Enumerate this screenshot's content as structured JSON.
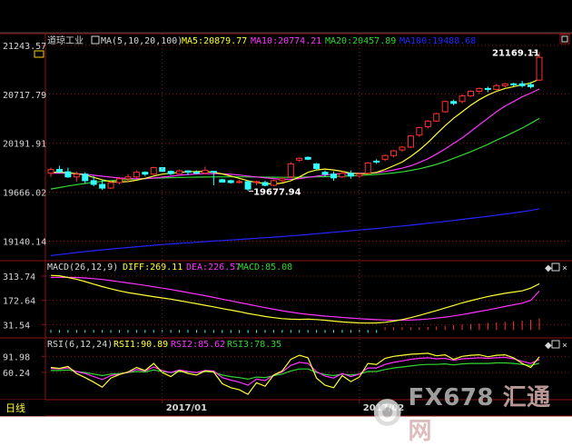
{
  "colors": {
    "bg": "#000000",
    "axis": "#8c1515",
    "text": "#d6d6d6",
    "yellow": "#ffff33",
    "magenta": "#ff33ff",
    "green": "#33d633",
    "blue": "#2424ff",
    "up": "#ff3333",
    "down": "#33ffff",
    "label": "#ffffff"
  },
  "main_panel": {
    "instrument": "道琼工业",
    "ma_params": "MA(5,10,20,100)",
    "ma5": "MA5:20879.77",
    "ma10": "MA10:20774.21",
    "ma20": "MA20:20457.89",
    "ma100": "MA100:19488.68",
    "high_label": "21169.11",
    "low_label": "19677.94"
  },
  "macd_panel": {
    "params": "MACD(26,12,9)",
    "diff": "DIFF:269.11",
    "dea": "DEA:226.57",
    "macd": "MACD:85.08"
  },
  "rsi_panel": {
    "params": "RSI(6,12,24)",
    "rsi1": "RSI1:90.89",
    "rsi2": "RSI2:85.62",
    "rsi3": "RSI3:78.35"
  },
  "period_label": "日线",
  "watermark": {
    "prefix": "FX678",
    "suffix": "汇通网"
  },
  "chart_data": [
    {
      "type": "candlestick",
      "title": "道琼工业",
      "x_labels": [
        "2017/01",
        "2017/02"
      ],
      "y_ticks": [
        21243.57,
        20717.79,
        20191.91,
        19666.02,
        19140.14
      ],
      "ylim": [
        18950,
        21340
      ],
      "candles": [
        {
          "o": 19870,
          "h": 19930,
          "l": 19830,
          "c": 19910
        },
        {
          "o": 19910,
          "h": 19950,
          "l": 19870,
          "c": 19885
        },
        {
          "o": 19885,
          "h": 19930,
          "l": 19820,
          "c": 19830
        },
        {
          "o": 19830,
          "h": 19890,
          "l": 19780,
          "c": 19860
        },
        {
          "o": 19860,
          "h": 19880,
          "l": 19760,
          "c": 19790
        },
        {
          "o": 19790,
          "h": 19840,
          "l": 19730,
          "c": 19750
        },
        {
          "o": 19750,
          "h": 19800,
          "l": 19690,
          "c": 19710
        },
        {
          "o": 19710,
          "h": 19790,
          "l": 19700,
          "c": 19770
        },
        {
          "o": 19770,
          "h": 19830,
          "l": 19750,
          "c": 19810
        },
        {
          "o": 19810,
          "h": 19860,
          "l": 19770,
          "c": 19830
        },
        {
          "o": 19830,
          "h": 19900,
          "l": 19810,
          "c": 19880
        },
        {
          "o": 19880,
          "h": 19890,
          "l": 19840,
          "c": 19860
        },
        {
          "o": 19860,
          "h": 19940,
          "l": 19850,
          "c": 19930
        },
        {
          "o": 19930,
          "h": 19935,
          "l": 19880,
          "c": 19890
        },
        {
          "o": 19890,
          "h": 19900,
          "l": 19850,
          "c": 19865
        },
        {
          "o": 19865,
          "h": 19910,
          "l": 19860,
          "c": 19895
        },
        {
          "o": 19895,
          "h": 19900,
          "l": 19850,
          "c": 19880
        },
        {
          "o": 19880,
          "h": 19900,
          "l": 19860,
          "c": 19870
        },
        {
          "o": 19870,
          "h": 19940,
          "l": 19860,
          "c": 19900
        },
        {
          "o": 19890,
          "h": 19895,
          "l": 19740,
          "c": 19885
        },
        {
          "o": 19800,
          "h": 19810,
          "l": 19770,
          "c": 19775
        },
        {
          "o": 19790,
          "h": 19800,
          "l": 19760,
          "c": 19770
        },
        {
          "o": 19775,
          "h": 19800,
          "l": 19760,
          "c": 19780
        },
        {
          "o": 19780,
          "h": 19790,
          "l": 19677.94,
          "c": 19700
        },
        {
          "o": 19770,
          "h": 19790,
          "l": 19740,
          "c": 19780
        },
        {
          "o": 19770,
          "h": 19790,
          "l": 19730,
          "c": 19740
        },
        {
          "o": 19740,
          "h": 19800,
          "l": 19730,
          "c": 19790
        },
        {
          "o": 19790,
          "h": 19830,
          "l": 19770,
          "c": 19810
        },
        {
          "o": 19830,
          "h": 19990,
          "l": 19820,
          "c": 19970
        },
        {
          "o": 20010,
          "h": 20040,
          "l": 19990,
          "c": 20030
        },
        {
          "o": 20040,
          "h": 20050,
          "l": 20010,
          "c": 20020
        },
        {
          "o": 19970,
          "h": 19980,
          "l": 19900,
          "c": 19920
        },
        {
          "o": 19880,
          "h": 19900,
          "l": 19830,
          "c": 19860
        },
        {
          "o": 19860,
          "h": 19890,
          "l": 19790,
          "c": 19820
        },
        {
          "o": 19830,
          "h": 19890,
          "l": 19820,
          "c": 19870
        },
        {
          "o": 19870,
          "h": 19900,
          "l": 19810,
          "c": 19840
        },
        {
          "o": 19840,
          "h": 19870,
          "l": 19820,
          "c": 19860
        },
        {
          "o": 19870,
          "h": 19990,
          "l": 19860,
          "c": 19980
        },
        {
          "o": 20000,
          "h": 20020,
          "l": 19970,
          "c": 19990
        },
        {
          "o": 20020,
          "h": 20070,
          "l": 20000,
          "c": 20060
        },
        {
          "o": 20060,
          "h": 20120,
          "l": 20040,
          "c": 20110
        },
        {
          "o": 20120,
          "h": 20160,
          "l": 20100,
          "c": 20150
        },
        {
          "o": 20150,
          "h": 20280,
          "l": 20140,
          "c": 20270
        },
        {
          "o": 20280,
          "h": 20370,
          "l": 20260,
          "c": 20360
        },
        {
          "o": 20370,
          "h": 20440,
          "l": 20350,
          "c": 20430
        },
        {
          "o": 20430,
          "h": 20520,
          "l": 20420,
          "c": 20510
        },
        {
          "o": 20530,
          "h": 20650,
          "l": 20520,
          "c": 20640
        },
        {
          "o": 20640,
          "h": 20660,
          "l": 20600,
          "c": 20620
        },
        {
          "o": 20640,
          "h": 20720,
          "l": 20620,
          "c": 20700
        },
        {
          "o": 20700,
          "h": 20760,
          "l": 20690,
          "c": 20750
        },
        {
          "o": 20750,
          "h": 20790,
          "l": 20720,
          "c": 20780
        },
        {
          "o": 20780,
          "h": 20800,
          "l": 20740,
          "c": 20770
        },
        {
          "o": 20770,
          "h": 20830,
          "l": 20760,
          "c": 20810
        },
        {
          "o": 20810,
          "h": 20840,
          "l": 20790,
          "c": 20830
        },
        {
          "o": 20830,
          "h": 20840,
          "l": 20800,
          "c": 20820
        },
        {
          "o": 20830,
          "h": 20860,
          "l": 20790,
          "c": 20810
        },
        {
          "o": 20820,
          "h": 20850,
          "l": 20780,
          "c": 20800
        },
        {
          "o": 20870,
          "h": 21169.11,
          "l": 20860,
          "c": 21115
        }
      ],
      "ma": {
        "MA5": [
          19880,
          19882,
          19875,
          19865,
          19850,
          19825,
          19800,
          19780,
          19775,
          19780,
          19795,
          19815,
          19840,
          19860,
          19870,
          19880,
          19885,
          19888,
          19887,
          19880,
          19862,
          19840,
          19815,
          19790,
          19770,
          19760,
          19755,
          19765,
          19790,
          19830,
          19880,
          19905,
          19915,
          19905,
          19890,
          19870,
          19865,
          19865,
          19880,
          19910,
          19950,
          19990,
          20050,
          20120,
          20200,
          20290,
          20380,
          20460,
          20530,
          20600,
          20660,
          20710,
          20750,
          20780,
          20800,
          20820,
          20840,
          20879.77
        ],
        "MA10": [
          19870,
          19872,
          19870,
          19865,
          19858,
          19848,
          19838,
          19828,
          19818,
          19812,
          19810,
          19812,
          19818,
          19828,
          19838,
          19848,
          19856,
          19862,
          19865,
          19866,
          19864,
          19858,
          19850,
          19840,
          19830,
          19820,
          19812,
          19805,
          19805,
          19812,
          19825,
          19838,
          19850,
          19860,
          19865,
          19868,
          19868,
          19870,
          19876,
          19888,
          19905,
          19925,
          19950,
          19985,
          20025,
          20075,
          20130,
          20190,
          20250,
          20320,
          20390,
          20460,
          20530,
          20590,
          20640,
          20690,
          20730,
          20774.21
        ],
        "MA20": [
          19700,
          19716,
          19732,
          19747,
          19760,
          19772,
          19782,
          19790,
          19797,
          19803,
          19808,
          19812,
          19816,
          19819,
          19822,
          19824,
          19826,
          19828,
          19829,
          19830,
          19831,
          19831,
          19831,
          19830,
          19829,
          19828,
          19827,
          19826,
          19826,
          19827,
          19829,
          19831,
          19833,
          19836,
          19839,
          19842,
          19846,
          19851,
          19857,
          19864,
          19873,
          19885,
          19900,
          19918,
          19940,
          19965,
          19995,
          20030,
          20065,
          20100,
          20140,
          20180,
          20225,
          20265,
          20310,
          20355,
          20405,
          20457.89
        ],
        "MA100": [
          18985,
          18996,
          19007,
          19018,
          19028,
          19038,
          19047,
          19056,
          19064,
          19072,
          19080,
          19088,
          19096,
          19103,
          19110,
          19117,
          19123,
          19129,
          19135,
          19141,
          19147,
          19153,
          19159,
          19165,
          19171,
          19177,
          19183,
          19190,
          19197,
          19204,
          19212,
          19220,
          19228,
          19236,
          19244,
          19252,
          19260,
          19268,
          19276,
          19285,
          19294,
          19303,
          19312,
          19322,
          19332,
          19342,
          19352,
          19363,
          19374,
          19385,
          19396,
          19408,
          19420,
          19432,
          19444,
          19456,
          19470,
          19488.68
        ]
      }
    },
    {
      "type": "line",
      "title": "MACD(26,12,9)",
      "y_ticks": [
        313.74,
        172.64,
        31.54
      ],
      "ylim": [
        -25,
        335
      ],
      "series": [
        {
          "name": "DIFF",
          "values": [
            318,
            316,
            306,
            296,
            282,
            267,
            253,
            240,
            228,
            218,
            210,
            202,
            194,
            187,
            180,
            171,
            162,
            153,
            144,
            135,
            125,
            116,
            107,
            96,
            88,
            79,
            72,
            66,
            63,
            62,
            63,
            61,
            57,
            52,
            47,
            44,
            41,
            40,
            41,
            45,
            52,
            61,
            72,
            85,
            99,
            113,
            128,
            143,
            158,
            171,
            183,
            195,
            205,
            214,
            221,
            228,
            244,
            269.11
          ]
        },
        {
          "name": "DEA",
          "values": [
            306,
            307,
            307,
            306,
            303,
            299,
            294,
            288,
            281,
            274,
            267,
            260,
            252,
            244,
            236,
            227,
            218,
            209,
            200,
            190,
            180,
            170,
            160,
            150,
            140,
            130,
            121,
            112,
            104,
            97,
            91,
            86,
            81,
            77,
            73,
            70,
            66,
            63,
            60,
            58,
            57,
            57,
            58,
            60,
            64,
            69,
            75,
            82,
            90,
            99,
            108,
            117,
            127,
            137,
            147,
            156,
            173,
            226.57
          ]
        },
        {
          "name": "MACD",
          "values": [
            -3,
            -4,
            -5,
            -6,
            -7,
            -8,
            -9,
            -10,
            -12,
            -14,
            -15,
            -16,
            -17,
            -18,
            -18,
            -19,
            -20,
            -20,
            -21,
            -21,
            -22,
            -22,
            -23,
            -22,
            -21,
            -20,
            -19,
            -18,
            -16,
            -14,
            -12,
            -10,
            -9,
            -8,
            -7,
            -6,
            -5,
            -4,
            -2,
            2,
            5,
            9,
            13,
            18,
            22,
            26,
            30,
            35,
            40,
            44,
            48,
            52,
            56,
            60,
            64,
            68,
            74,
            85.08
          ]
        }
      ]
    },
    {
      "type": "line",
      "title": "RSI(6,12,24)",
      "y_ticks": [
        91.98,
        60.24
      ],
      "ylim": [
        10,
        105
      ],
      "series": [
        {
          "name": "RSI1",
          "values": [
            70,
            68,
            72,
            58,
            50,
            41,
            31,
            49,
            56,
            61,
            70,
            64,
            78,
            60,
            52,
            64,
            58,
            55,
            63,
            61,
            38,
            30,
            26,
            17,
            40,
            33,
            55,
            63,
            86,
            94,
            89,
            49,
            35,
            30,
            54,
            42,
            51,
            78,
            76,
            88,
            92,
            94,
            96,
            97,
            98,
            93,
            95,
            86,
            92,
            94,
            95,
            91,
            94,
            95,
            89,
            78,
            70,
            90.89
          ]
        },
        {
          "name": "RSI2",
          "values": [
            68,
            67,
            69,
            62,
            58,
            52,
            46,
            54,
            57,
            60,
            66,
            63,
            71,
            64,
            60,
            65,
            62,
            60,
            64,
            63,
            50,
            45,
            41,
            35,
            47,
            44,
            55,
            61,
            74,
            80,
            78,
            62,
            53,
            49,
            58,
            52,
            57,
            69,
            69,
            76,
            80,
            83,
            86,
            88,
            89,
            87,
            88,
            84,
            87,
            88,
            89,
            88,
            89,
            90,
            87,
            82,
            78,
            85.62
          ]
        },
        {
          "name": "RSI3",
          "values": [
            64,
            64,
            65,
            62,
            60,
            57,
            54,
            57,
            58,
            60,
            62,
            61,
            65,
            62,
            60,
            62,
            61,
            60,
            62,
            61,
            55,
            52,
            50,
            47,
            51,
            50,
            54,
            57,
            63,
            67,
            67,
            60,
            56,
            54,
            57,
            55,
            57,
            62,
            62,
            66,
            69,
            71,
            73,
            75,
            76,
            76,
            77,
            75,
            77,
            78,
            78,
            78,
            79,
            79,
            78,
            76,
            74,
            78.35
          ]
        }
      ]
    }
  ]
}
